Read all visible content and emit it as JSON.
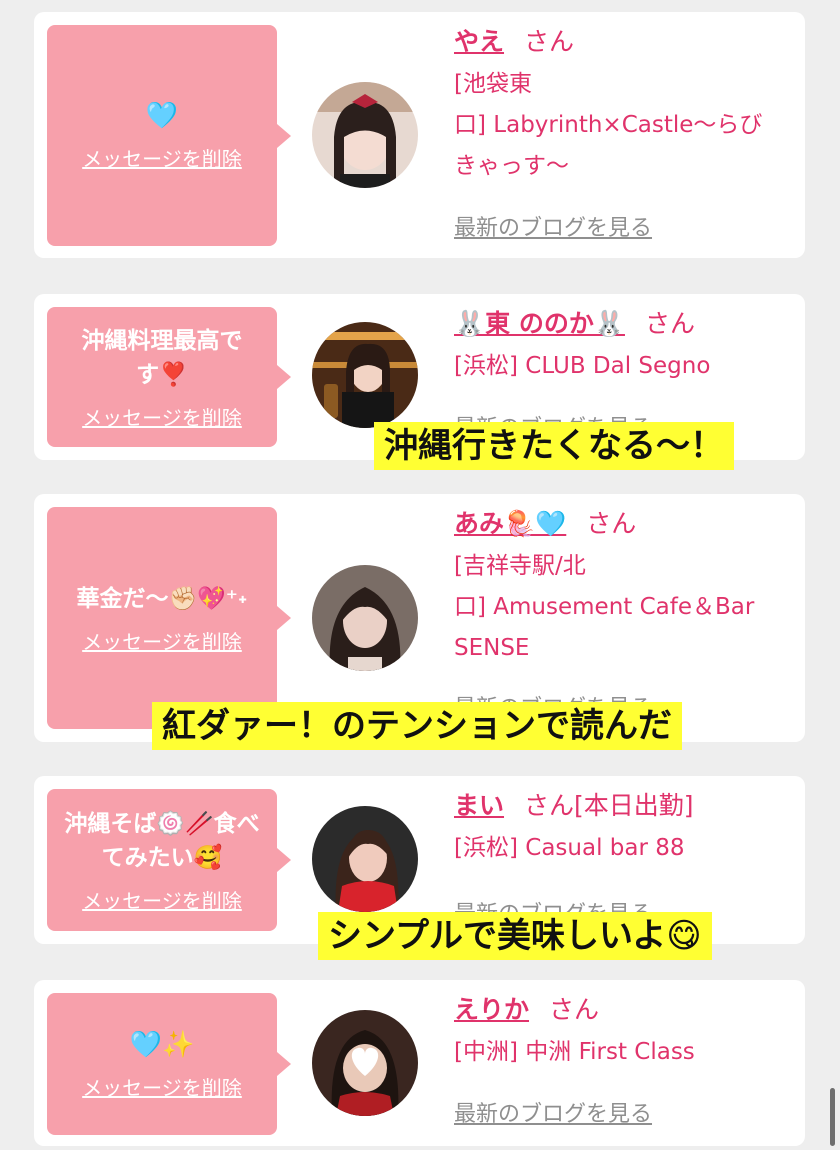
{
  "delete_label": "メッセージを削除",
  "san_label": "さん",
  "blog_label": "最新のブログを見る",
  "cards": [
    {
      "message": "",
      "message_emoji": "🩵",
      "name": "やえ",
      "attendance": "",
      "shop": "[池袋東\n口] Labyrinth×Castle〜らび\nきゃっす〜"
    },
    {
      "message": "沖縄料理最高で\nす❣️",
      "name": "🐰東 ののか🐰",
      "attendance": "",
      "shop": "[浜松] CLUB Dal Segno"
    },
    {
      "message": "華金だ〜✊🏻💖⁺˖",
      "name": "あみ🪼🩵",
      "attendance": "",
      "shop": "[吉祥寺駅/北\n口] Amusement Cafe＆Bar\nSENSE"
    },
    {
      "message": "沖縄そば🍥🥢食べ\nてみたい🥰",
      "name": "まい",
      "attendance": "[本日出勤]",
      "shop": "[浜松] Casual bar 88"
    },
    {
      "message": "",
      "message_emoji": "🩵✨",
      "name": "えりか",
      "attendance": "",
      "shop": "[中洲] 中洲 First Class"
    }
  ],
  "captions": [
    "沖縄行きたくなる〜！",
    "紅ダァー！のテンションで読んだ",
    "シンプルで美味しいよ😋"
  ],
  "colors": {
    "background": "#eeeeee",
    "card": "#ffffff",
    "bubble": "#f7a0ab",
    "accent": "#e0336b",
    "link_gray": "#8f8f8f",
    "caption_bg": "#ffff33"
  }
}
